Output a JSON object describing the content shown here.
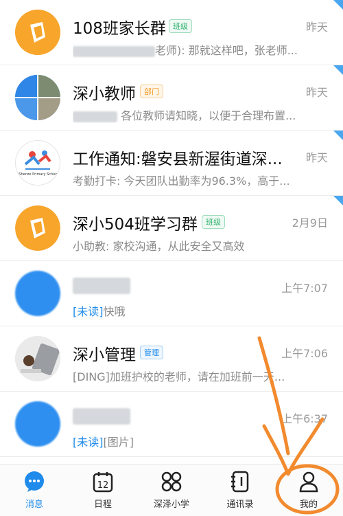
{
  "chats": [
    {
      "title": "108班家长群",
      "tag": "班级",
      "time": "昨天",
      "preview_visible": "老师): 那就这样吧，张老师..."
    },
    {
      "title": "深小教师",
      "tag": "部门",
      "time": "昨天",
      "preview_visible": "各位教师请知晓，以便于合理布置..."
    },
    {
      "title": "工作通知:磐安县新渥街道深...",
      "time": "昨天",
      "preview_visible": "考勤打卡: 今天团队出勤率为96.3%，高于...",
      "logo_text": "Shenze Primary School"
    },
    {
      "title": "深小504班学习群",
      "tag": "班级",
      "time": "2月9日",
      "preview_visible": "小助教: 家校沟通，从此安全又高效"
    },
    {
      "time": "上午7:07",
      "unread_prefix": "[未读]",
      "preview_visible": "快哦"
    },
    {
      "title": "深小管理",
      "tag": "管理",
      "time": "上午7:06",
      "preview_visible": "[DING]加班护校的老师，请在加班前一天..."
    },
    {
      "time": "上午6:37",
      "unread_prefix": "[未读]",
      "preview_visible": "[图片]"
    }
  ],
  "nav": {
    "messages": {
      "label": "消息",
      "icon": "chat-bubble-icon"
    },
    "calendar": {
      "label": "日程",
      "icon": "calendar-icon",
      "date": "12"
    },
    "school": {
      "label": "深泽小学",
      "icon": "grid-apps-icon"
    },
    "contacts": {
      "label": "通讯录",
      "icon": "contacts-book-icon"
    },
    "mine": {
      "label": "我的",
      "icon": "person-icon"
    }
  },
  "colors": {
    "accent": "#1f8bea",
    "class_tag": "#2ab06a",
    "dept_tag": "#f39a22",
    "annotation": "#f28a2e"
  }
}
